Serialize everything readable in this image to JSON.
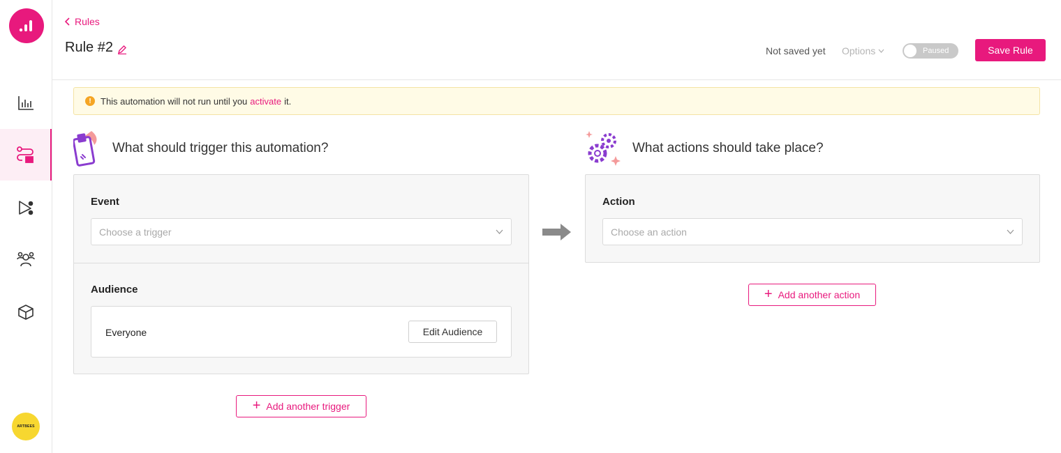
{
  "sidebar": {
    "items": [
      {
        "name": "analytics",
        "icon": "bar-chart-icon",
        "active": false
      },
      {
        "name": "rules",
        "icon": "rules-icon",
        "active": true
      },
      {
        "name": "flows",
        "icon": "flow-icon",
        "active": false
      },
      {
        "name": "audience",
        "icon": "users-icon",
        "active": false
      },
      {
        "name": "integrations",
        "icon": "box-icon",
        "active": false
      }
    ],
    "avatar_text": "ARTBEES"
  },
  "header": {
    "breadcrumb": "Rules",
    "title": "Rule #2",
    "save_status": "Not saved yet",
    "options_label": "Options",
    "toggle_label": "Paused",
    "save_button": "Save Rule"
  },
  "notice": {
    "text_before": "This automation will not run until you",
    "link": "activate",
    "text_after": "it."
  },
  "trigger": {
    "heading": "What should trigger this automation?",
    "event_label": "Event",
    "event_placeholder": "Choose a trigger",
    "audience_label": "Audience",
    "audience_value": "Everyone",
    "edit_audience_button": "Edit Audience",
    "add_button": "Add another trigger"
  },
  "action": {
    "heading": "What actions should take place?",
    "action_label": "Action",
    "action_placeholder": "Choose an action",
    "add_button": "Add another action"
  },
  "colors": {
    "accent": "#e8197d",
    "notice_bg": "#fffbe6",
    "warn": "#f5a524"
  }
}
